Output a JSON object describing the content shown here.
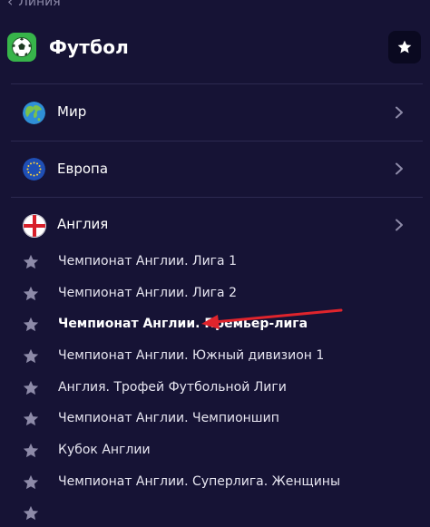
{
  "nav": {
    "back_label": "Линия"
  },
  "header": {
    "title": "Футбол",
    "sport_icon": "soccer-ball-icon",
    "favorite_icon": "star-icon"
  },
  "regions": [
    {
      "label": "Мир",
      "icon": "globe-icon"
    },
    {
      "label": "Европа",
      "icon": "eu-flag-icon"
    },
    {
      "label": "Англия",
      "icon": "england-flag-icon"
    }
  ],
  "leagues": [
    {
      "label": "Чемпионат Англии. Лига 1"
    },
    {
      "label": "Чемпионат Англии. Лига 2"
    },
    {
      "label": "Чемпионат Англии. Премьер-лига",
      "highlighted": true
    },
    {
      "label": "Чемпионат Англии. Южный дивизион 1"
    },
    {
      "label": "Англия. Трофей Футбольной Лиги"
    },
    {
      "label": "Чемпионат Англии. Чемпионшип"
    },
    {
      "label": "Кубок Англии"
    },
    {
      "label": "Чемпионат Англии. Суперлига. Женщины"
    }
  ],
  "colors": {
    "background": "#161335",
    "divider": "#2c2950",
    "star": "#8d8aa8",
    "annotation_arrow": "#e0242c",
    "sport_icon_bg": "#37b44a"
  }
}
